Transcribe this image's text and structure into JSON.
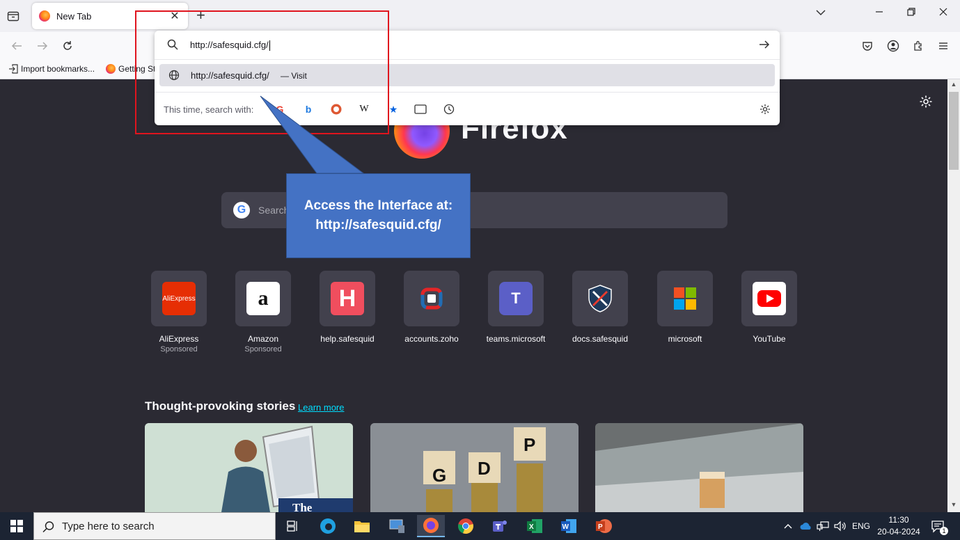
{
  "browser": {
    "tab_title": "New Tab",
    "tab_close": "✕",
    "new_tab": "+"
  },
  "bookmarks": {
    "import": "Import bookmarks...",
    "getting_started": "Getting St"
  },
  "urlbar": {
    "value": "http://safesquid.cfg/",
    "result_url": "http://safesquid.cfg/",
    "result_action": "— Visit",
    "search_with_label": "This time, search with:",
    "engines": [
      "google-icon",
      "bing-icon",
      "duckduckgo-icon",
      "wikipedia-icon",
      "bookmarks-star-icon",
      "tabs-icon",
      "history-icon"
    ]
  },
  "callout": {
    "line1": "Access the Interface at:",
    "line2": "http://safesquid.cfg/"
  },
  "newtab": {
    "brand": "Firefox",
    "search_placeholder": "Search",
    "top_sites": [
      {
        "name": "AliExpress",
        "sponsored": "Sponsored",
        "icon_text": "AliExpress"
      },
      {
        "name": "Amazon",
        "sponsored": "Sponsored",
        "icon_text": "a"
      },
      {
        "name": "help.safesquid",
        "sponsored": "",
        "icon_text": "H"
      },
      {
        "name": "accounts.zoho",
        "sponsored": "",
        "icon_text": ""
      },
      {
        "name": "teams.microsoft",
        "sponsored": "",
        "icon_text": "T"
      },
      {
        "name": "docs.safesquid",
        "sponsored": "",
        "icon_text": ""
      },
      {
        "name": "microsoft",
        "sponsored": "",
        "icon_text": ""
      },
      {
        "name": "YouTube",
        "sponsored": "",
        "icon_text": ""
      }
    ],
    "stories_title": "Thought-provoking stories",
    "learn_more": "Learn more",
    "card_gdp_letters": [
      "G",
      "D",
      "P"
    ],
    "card1_text": "The"
  },
  "taskbar": {
    "search_placeholder": "Type here to search",
    "lang": "ENG",
    "time": "11:30",
    "date": "20-04-2024",
    "notification_count": "1"
  },
  "colors": {
    "callout": "#4472c4",
    "highlight": "#e0141e",
    "page_bg": "#2b2a33",
    "tile_bg": "#42414d"
  }
}
